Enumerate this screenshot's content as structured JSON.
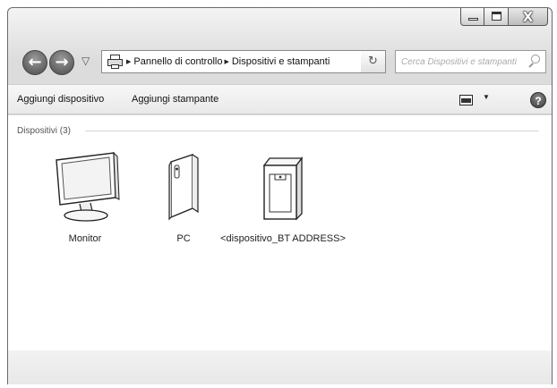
{
  "window": {
    "caption_buttons": [
      "minimize-icon",
      "maximize-icon",
      "close-icon"
    ],
    "close_glyph": "X"
  },
  "nav": {
    "back_glyph": "←",
    "forward_glyph": "→",
    "history_glyph": "▽",
    "address": {
      "icon": "devices-printers-icon",
      "separator": "▶",
      "crumbs": [
        "Pannello di controllo",
        "Dispositivi e stampanti"
      ],
      "dropdown_glyph": "▼"
    },
    "refresh_glyph": "↻",
    "search": {
      "placeholder": "Cerca Dispositivi e stampanti",
      "icon": "search-icon"
    }
  },
  "toolbar": {
    "add_device": "Aggiungi dispositivo",
    "add_printer": "Aggiungi stampante",
    "view_dropdown_glyph": "▼",
    "help_glyph": "?"
  },
  "devices": {
    "group_label": "Dispositivi (3)",
    "items": [
      {
        "label": "Monitor",
        "icon": "monitor-icon"
      },
      {
        "label": "PC",
        "icon": "pc-icon"
      },
      {
        "label": "<dispositivo_BT ADDRESS>",
        "icon": "bluetooth-device-icon"
      }
    ]
  }
}
